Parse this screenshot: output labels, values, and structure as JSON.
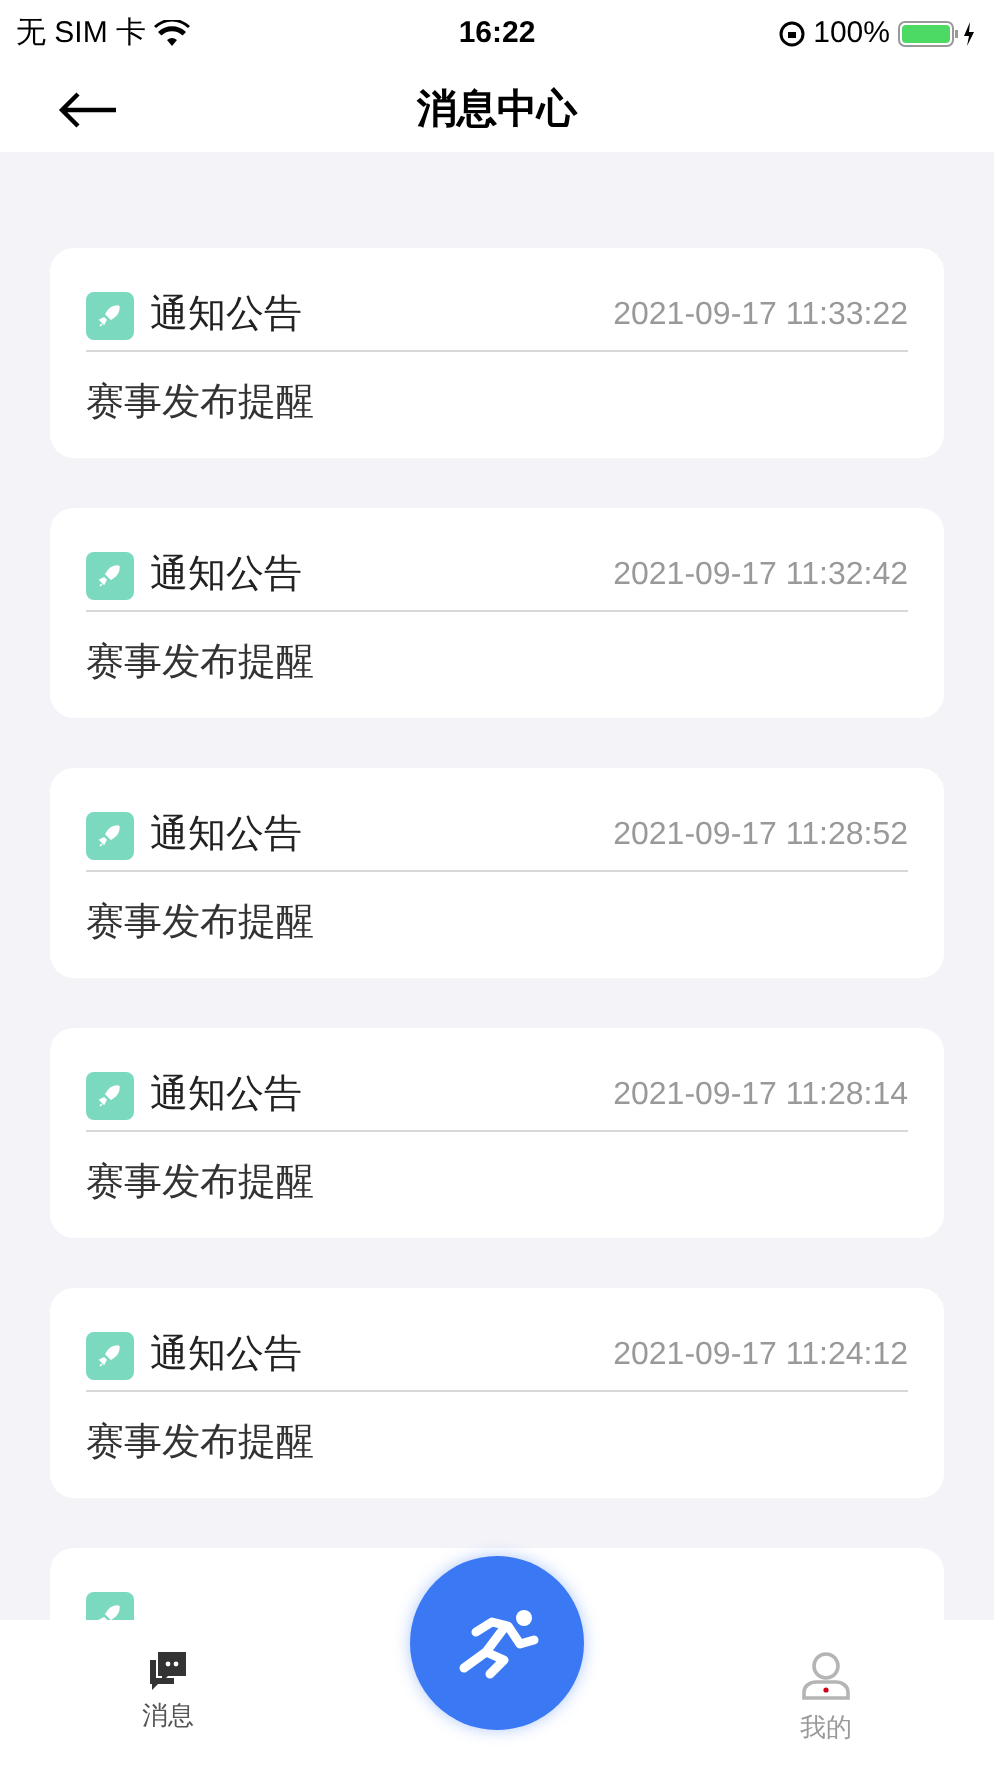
{
  "status_bar": {
    "carrier": "无 SIM 卡",
    "time": "16:22",
    "battery": "100%"
  },
  "nav": {
    "title": "消息中心"
  },
  "messages": [
    {
      "category": "通知公告",
      "time": "2021-09-17 11:33:22",
      "body": "赛事发布提醒"
    },
    {
      "category": "通知公告",
      "time": "2021-09-17 11:32:42",
      "body": "赛事发布提醒"
    },
    {
      "category": "通知公告",
      "time": "2021-09-17 11:28:52",
      "body": "赛事发布提醒"
    },
    {
      "category": "通知公告",
      "time": "2021-09-17 11:28:14",
      "body": "赛事发布提醒"
    },
    {
      "category": "通知公告",
      "time": "2021-09-17 11:24:12",
      "body": "赛事发布提醒"
    },
    {
      "kind": "partial"
    }
  ],
  "tab_bar": [
    {
      "kind": "messages",
      "label": "消息",
      "selected": true
    },
    {
      "kind": "profile",
      "label": "我的",
      "selected": false
    }
  ]
}
